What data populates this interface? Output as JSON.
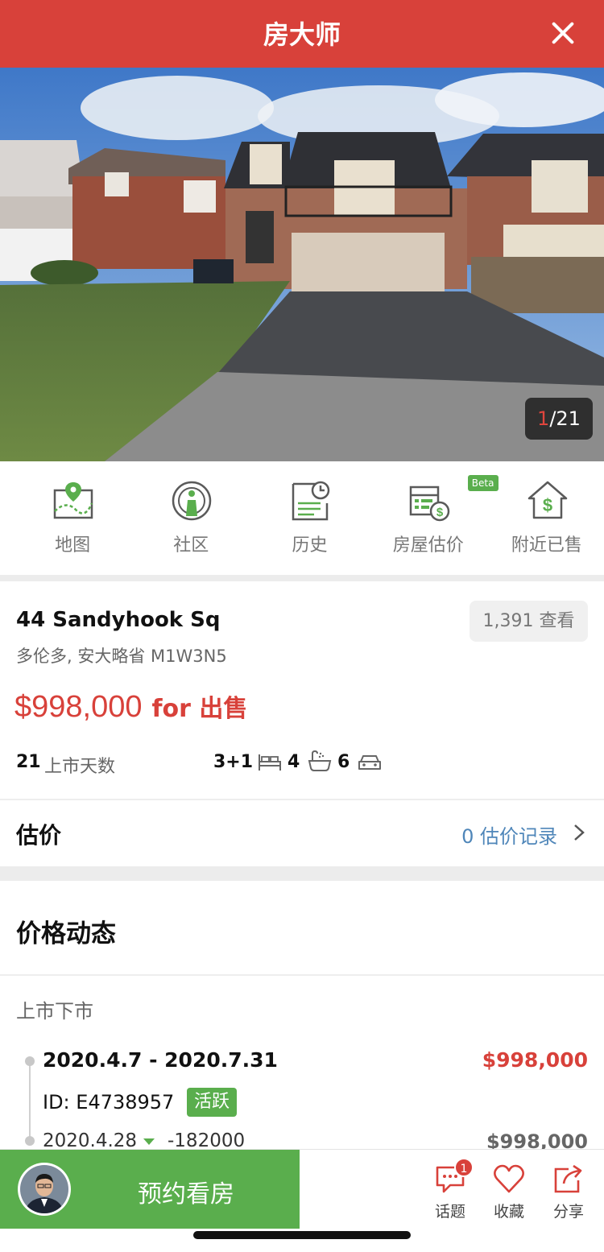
{
  "header": {
    "title": "房大师",
    "close_icon": "close-icon"
  },
  "photo": {
    "current": "1",
    "total": "/21"
  },
  "quicknav": [
    {
      "label": "地图",
      "icon": "map-pin-icon"
    },
    {
      "label": "社区",
      "icon": "community-icon"
    },
    {
      "label": "历史",
      "icon": "history-icon"
    },
    {
      "label": "房屋估价",
      "icon": "estimate-icon",
      "badge": "Beta"
    },
    {
      "label": "附近已售",
      "icon": "house-dollar-icon"
    }
  ],
  "listing": {
    "address": "44 Sandyhook Sq",
    "city": "多伦多, 安大略省 M1W3N5",
    "views": "1,391 查看",
    "price": "$998,000",
    "status": "for 出售",
    "days_on_market": "21",
    "days_label": "上市天数",
    "bedrooms": "3+1",
    "bathrooms": "4",
    "parking": "6"
  },
  "estimate": {
    "label": "估价",
    "link": "0 估价记录"
  },
  "price_history": {
    "title": "价格动态",
    "subtitle": "上市下市",
    "entry1": {
      "dates": "2020.4.7 - 2020.7.31",
      "price": "$998,000",
      "id": "ID: E4738957",
      "status": "活跃"
    },
    "entry2": {
      "date": "2020.4.28",
      "change": "-182000",
      "price": "$998,000"
    }
  },
  "bottom_bar": {
    "book_label": "预约看房",
    "topics_label": "话题",
    "topics_badge": "1",
    "favorite_label": "收藏",
    "share_label": "分享"
  },
  "colors": {
    "accent": "#d8413a",
    "green": "#5aae4d",
    "link": "#4f86b9"
  }
}
